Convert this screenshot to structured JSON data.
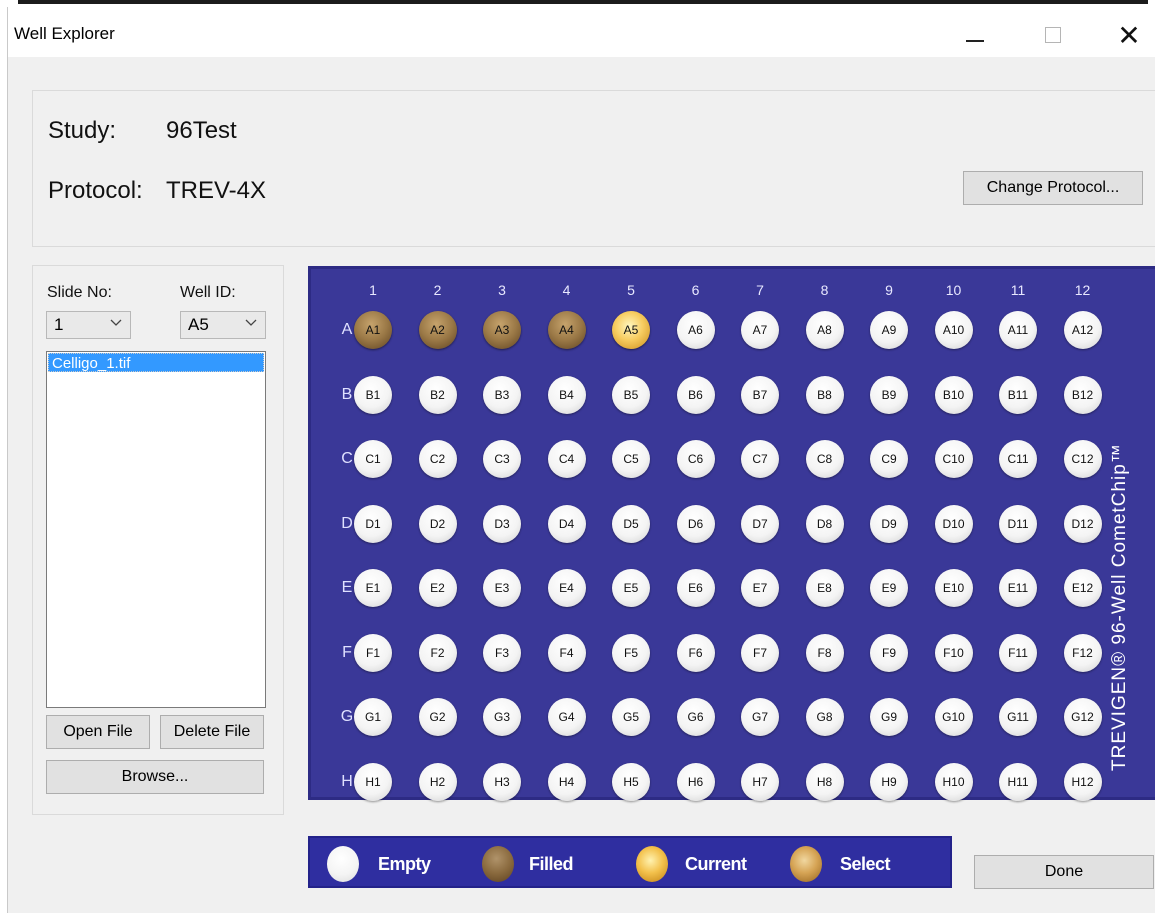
{
  "window": {
    "title": "Well Explorer"
  },
  "study": {
    "label": "Study:",
    "value": "96Test"
  },
  "protocol": {
    "label": "Protocol:",
    "value": "TREV-4X",
    "change_button": "Change Protocol..."
  },
  "left_panel": {
    "slide_label": "Slide No:",
    "slide_value": "1",
    "well_label": "Well ID:",
    "well_value": "A5",
    "files": [
      "Celligo_1.tif"
    ],
    "open_button": "Open File",
    "delete_button": "Delete File",
    "browse_button": "Browse..."
  },
  "plate": {
    "columns": [
      "1",
      "2",
      "3",
      "4",
      "5",
      "6",
      "7",
      "8",
      "9",
      "10",
      "11",
      "12"
    ],
    "rows": [
      "A",
      "B",
      "C",
      "D",
      "E",
      "F",
      "G",
      "H"
    ],
    "filled_wells": [
      "A1",
      "A2",
      "A3",
      "A4"
    ],
    "current_well": "A5",
    "brand_text": "TREVIGEN® 96-Well CometChip™"
  },
  "legend": {
    "empty": "Empty",
    "filled": "Filled",
    "current": "Current",
    "select": "Select"
  },
  "done_button": "Done",
  "colors": {
    "plate_bg": "#3a3898",
    "legend_bg": "#2f2ea0",
    "selection": "#3399ff"
  },
  "icons": {
    "minimize": "minimize-icon",
    "maximize": "maximize-icon",
    "close": "close-icon",
    "dropdown": "chevron-down-icon"
  }
}
